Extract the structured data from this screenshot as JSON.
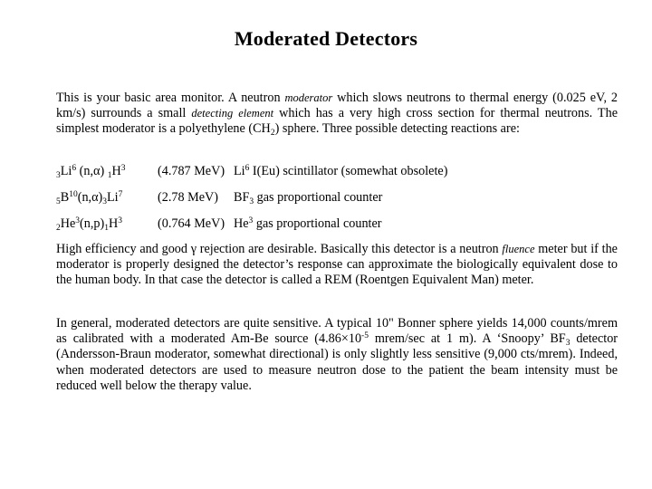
{
  "slide": {
    "title": "Moderated Detectors",
    "intro": {
      "t1": "This is your basic area monitor.  A neutron ",
      "moderator_italic": "moderator",
      "t2": "   which slows neutrons to thermal energy (0.025 eV, 2 km/s) surrounds a small ",
      "detecting_italic": "detecting",
      "t3": "   ",
      "element_italic": "element",
      "t4": "   which has a very high cross section for thermal neutrons. The simplest moderator is a polyethylene (CH",
      "ch_sub": "2",
      "t5": ") sphere. Three possible detecting reactions are:"
    },
    "reactions": [
      {
        "equation": {
          "a_pre": "3",
          "a": "Li",
          "a_sup": "6",
          "mid": " (n,α) ",
          "b_pre": "1",
          "b": "H",
          "b_sup": "3"
        },
        "energy": "(4.787 MeV)",
        "desc_pre": "Li",
        "desc_sup": "6",
        "desc_sub": "",
        "desc": " I(Eu) scintillator (somewhat obsolete)"
      },
      {
        "equation": {
          "a_pre": "5",
          "a": "B",
          "a_sup": "10",
          "mid": "(n,α)",
          "b_pre": "3",
          "b": "Li",
          "b_sup": "7"
        },
        "energy": "(2.78 MeV)",
        "desc_pre": "BF",
        "desc_sup": "",
        "desc_sub": "3",
        "desc": " gas proportional counter"
      },
      {
        "equation": {
          "a_pre": "2",
          "a": "He",
          "a_sup": "3",
          "mid": "(n,p)",
          "b_pre": "1",
          "b": "H",
          "b_sup": "3"
        },
        "energy": "(0.764 MeV)",
        "desc_pre": "He",
        "desc_sup": "3",
        "desc_sub": "",
        "desc": " gas proportional counter"
      }
    ],
    "efficiency": {
      "t1": "High efficiency and good γ rejection are desirable. Basically this detector is a neutron ",
      "fluence_italic": "fluence",
      "t2": "   meter but if the moderator is properly designed the detector’s response can approximate the biologically equivalent dose to the human body. In that case the detector is called a REM  (Roentgen Equivalent Man) meter."
    },
    "sensitivity": {
      "t1": "In general, moderated detectors are quite sensitive. A typical 10\" Bonner sphere yields 14,000 counts/mrem as calibrated with a moderated Am-Be source (4.86×10",
      "exp": "-5",
      "t2": " mrem/sec at 1 m). A ‘Snoopy’ BF",
      "bf_sub": "3",
      "t3": " detector (Andersson-Braun moderator, somewhat directional) is only slightly less sensitive (9,000 cts/mrem). Indeed, when moderated detectors are used to measure neutron dose to the patient the beam intensity must be reduced well below the therapy value."
    }
  }
}
